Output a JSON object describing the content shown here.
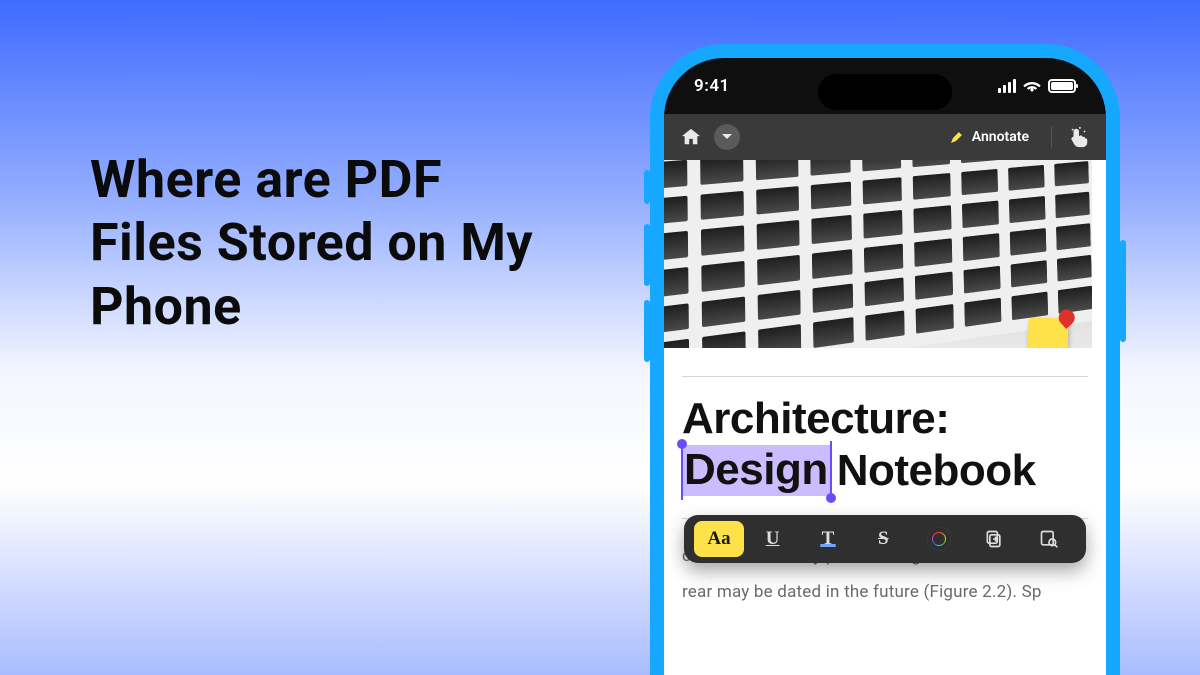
{
  "hero": {
    "headline": "Where are PDF Files Stored on My Phone"
  },
  "statusbar": {
    "time": "9:41"
  },
  "appbar": {
    "annotate_label": "Annotate"
  },
  "document": {
    "title_line1": "Architecture:",
    "title_highlight": "Design",
    "title_rest": "Notebook",
    "body_line1": "concrete masonry pier buildings at the front a",
    "body_line2": "rear may be dated in the future (Figure 2.2). Sp"
  },
  "toolbar": {
    "highlight_label": "Aa",
    "underline_label": "U",
    "squiggly_label": "T",
    "strike_label": "S"
  },
  "colors": {
    "phone_shell": "#16a8ff",
    "highlight": "#cbbcff",
    "selection": "#6a4cff",
    "marker": "#ffe24a"
  }
}
